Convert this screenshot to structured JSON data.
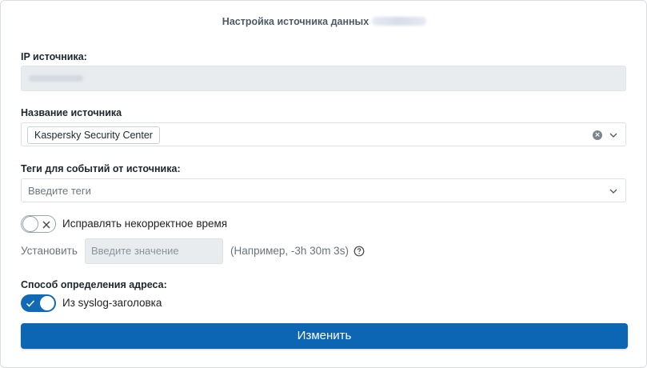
{
  "dialog": {
    "title": "Настройка источника данных"
  },
  "source_ip": {
    "label": "IP источника:"
  },
  "source_name": {
    "label": "Название источника",
    "selected": "Kaspersky Security Center"
  },
  "tags": {
    "label": "Теги для событий от источника:",
    "placeholder": "Введите теги"
  },
  "fix_time": {
    "toggle_label": "Исправлять некорректное время",
    "enabled": false,
    "set_label": "Установить",
    "input_placeholder": "Введите значение",
    "hint": "(Например, -3h 30m 3s)"
  },
  "address_method": {
    "label": "Способ определения адреса:",
    "toggle_label": "Из syslog-заголовка",
    "enabled": true
  },
  "submit": {
    "label": "Изменить"
  },
  "colors": {
    "accent": "#0d66b3",
    "border": "#dde1e6",
    "readonly_bg": "#e9ecef"
  },
  "icons": {
    "clear": "clear-icon",
    "dropdown": "chevron-down-icon",
    "help": "help-icon"
  }
}
